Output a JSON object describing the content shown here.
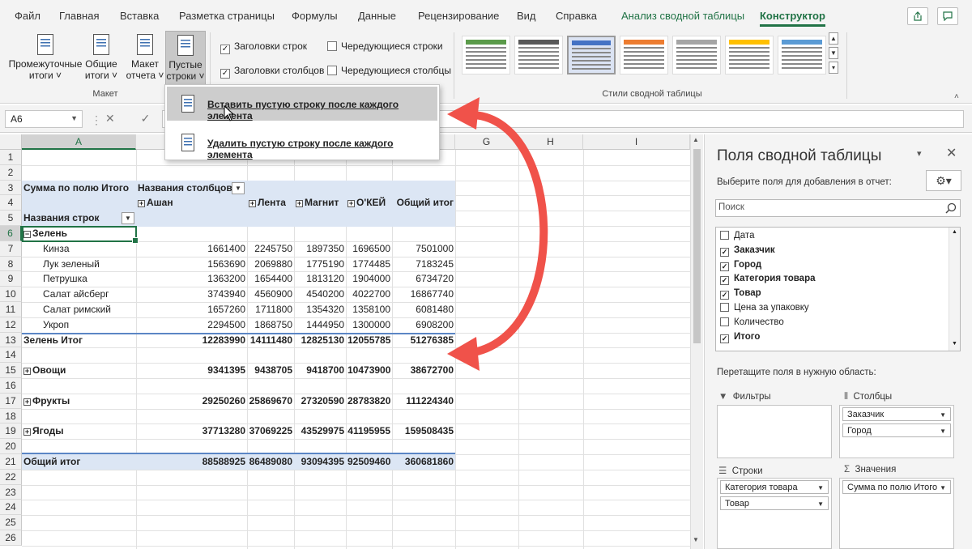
{
  "tabs": [
    "Файл",
    "Главная",
    "Вставка",
    "Разметка страницы",
    "Формулы",
    "Данные",
    "Рецензирование",
    "Вид",
    "Справка",
    "Анализ сводной таблицы",
    "Конструктор"
  ],
  "ribbon": {
    "buttons": {
      "subtotals": [
        "Промежуточные",
        "итоги ˅"
      ],
      "grandtotals": [
        "Общие",
        "итоги ˅"
      ],
      "report_layout": [
        "Макет",
        "отчета ˅"
      ],
      "blank_rows": [
        "Пустые",
        "строки ˅"
      ]
    },
    "group_layout": "Макет",
    "options": {
      "row_headers": "Заголовки строк",
      "col_headers": "Заголовки столбцов",
      "banded_rows": "Чередующиеся строки",
      "banded_cols": "Чередующиеся столбцы"
    },
    "group_styles": "Стили сводной таблицы",
    "style_colors": [
      "#5b9b4a",
      "#595959",
      "#4472c4",
      "#ed7d31",
      "#a5a5a5",
      "#ffc000",
      "#5b9bd5"
    ]
  },
  "formula_bar": {
    "name_box": "A6",
    "fx_icons": "✕ ✓ fx"
  },
  "menu": {
    "insert": "Вставить пустую строку после каждого элемента",
    "delete": "Удалить пустую строку после каждого элемента"
  },
  "grid": {
    "columns": [
      "A",
      "B",
      "C",
      "D",
      "E",
      "F",
      "G",
      "H",
      "I"
    ],
    "rows": [
      "1",
      "2",
      "3",
      "4",
      "5",
      "6",
      "7",
      "8",
      "9",
      "10",
      "11",
      "12",
      "13",
      "14",
      "15",
      "16",
      "17",
      "18",
      "19",
      "20",
      "21",
      "22",
      "23",
      "24",
      "25",
      "26"
    ],
    "pivot": {
      "value_label": "Сумма по полю Итого",
      "col_labels": "Названия столбцов",
      "row_labels": "Названия строк",
      "headers": [
        "Ашан",
        "Лента",
        "Магнит",
        "О'КЕЙ",
        "Общий итог"
      ],
      "group_zelen": "Зелень",
      "items": [
        {
          "name": "Кинза",
          "v": [
            "1661400",
            "2245750",
            "1897350",
            "1696500",
            "7501000"
          ]
        },
        {
          "name": "Лук зеленый",
          "v": [
            "1563690",
            "2069880",
            "1775190",
            "1774485",
            "7183245"
          ]
        },
        {
          "name": "Петрушка",
          "v": [
            "1363200",
            "1654400",
            "1813120",
            "1904000",
            "6734720"
          ]
        },
        {
          "name": "Салат айсберг",
          "v": [
            "3743940",
            "4560900",
            "4540200",
            "4022700",
            "16867740"
          ]
        },
        {
          "name": "Салат римский",
          "v": [
            "1657260",
            "1711800",
            "1354320",
            "1358100",
            "6081480"
          ]
        },
        {
          "name": "Укроп",
          "v": [
            "2294500",
            "1868750",
            "1444950",
            "1300000",
            "6908200"
          ]
        }
      ],
      "zelen_total": {
        "name": "Зелень Итог",
        "v": [
          "12283990",
          "14111480",
          "12825130",
          "12055785",
          "51276385"
        ]
      },
      "groups": [
        {
          "name": "Овощи",
          "v": [
            "9341395",
            "9438705",
            "9418700",
            "10473900",
            "38672700"
          ]
        },
        {
          "name": "Фрукты",
          "v": [
            "29250260",
            "25869670",
            "27320590",
            "28783820",
            "111224340"
          ]
        },
        {
          "name": "Ягоды",
          "v": [
            "37713280",
            "37069225",
            "43529975",
            "41195955",
            "159508435"
          ]
        }
      ],
      "grand_total": {
        "name": "Общий итог",
        "v": [
          "88588925",
          "86489080",
          "93094395",
          "92509460",
          "360681860"
        ]
      }
    }
  },
  "pane": {
    "title": "Поля сводной таблицы",
    "subtitle": "Выберите поля для добавления в отчет:",
    "search_placeholder": "Поиск",
    "fields": [
      {
        "name": "Дата",
        "checked": false
      },
      {
        "name": "Заказчик",
        "checked": true
      },
      {
        "name": "Город",
        "checked": true
      },
      {
        "name": "Категория товара",
        "checked": true
      },
      {
        "name": "Товар",
        "checked": true
      },
      {
        "name": "Цена за упаковку",
        "checked": false
      },
      {
        "name": "Количество",
        "checked": false
      },
      {
        "name": "Итого",
        "checked": true
      }
    ],
    "drag_hint": "Перетащите поля в нужную область:",
    "filters": "Фильтры",
    "columns": "Столбцы",
    "rows": "Строки",
    "values": "Значения",
    "columns_items": [
      "Заказчик",
      "Город"
    ],
    "rows_items": [
      "Категория товара",
      "Товар"
    ],
    "values_items": [
      "Сумма по полю Итого"
    ]
  },
  "arrow_color": "#f0524a",
  "accent": "#217346"
}
